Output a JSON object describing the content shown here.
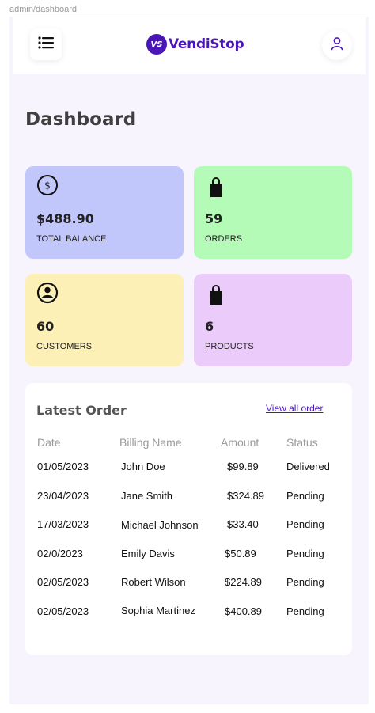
{
  "frame": {
    "label": "admin/dashboard"
  },
  "header": {
    "brand_mark": "VS",
    "brand_name": "VendiStop",
    "menu_icon": "list-icon",
    "profile_icon": "user-icon"
  },
  "page": {
    "title": "Dashboard"
  },
  "stats": {
    "balance": {
      "value": "$488.90",
      "label": "TOTAL BALANCE",
      "icon": "dollar-circle-icon",
      "color": "#c2c7fb"
    },
    "orders": {
      "value": "59",
      "label": "ORDERS",
      "icon": "shopping-bag-icon",
      "color": "#b3fbb6"
    },
    "customers": {
      "value": "60",
      "label": "CUSTOMERS",
      "icon": "user-circle-icon",
      "color": "#fdf0b7"
    },
    "products": {
      "value": "6",
      "label": "PRODUCTS",
      "icon": "shopping-bag-icon",
      "color": "#ebcbfa"
    }
  },
  "latest_order": {
    "title": "Latest Order",
    "view_all": "View all order",
    "columns": [
      "Date",
      "Billing Name",
      "Amount",
      "Status"
    ],
    "rows": [
      {
        "date": "01/05/2023",
        "name": "John Doe",
        "amount": "$99.89",
        "status": "Delivered"
      },
      {
        "date": "23/04/2023",
        "name": "Jane Smith",
        "amount": "$324.89",
        "status": "Pending"
      },
      {
        "date": "17/03/2023",
        "name": "Michael Johnson",
        "amount": "$33.40",
        "status": "Pending"
      },
      {
        "date": "02/0/2023",
        "name": "Emily Davis",
        "amount": "$50.89",
        "status": "Pending"
      },
      {
        "date": "02/05/2023",
        "name": "Robert Wilson",
        "amount": "$224.89",
        "status": "Pending"
      },
      {
        "date": "02/05/2023",
        "name": "Sophia Martinez",
        "amount": "$400.89",
        "status": "Pending"
      }
    ]
  },
  "colors": {
    "brand": "#4b16b8",
    "background": "#f8f4fe"
  }
}
